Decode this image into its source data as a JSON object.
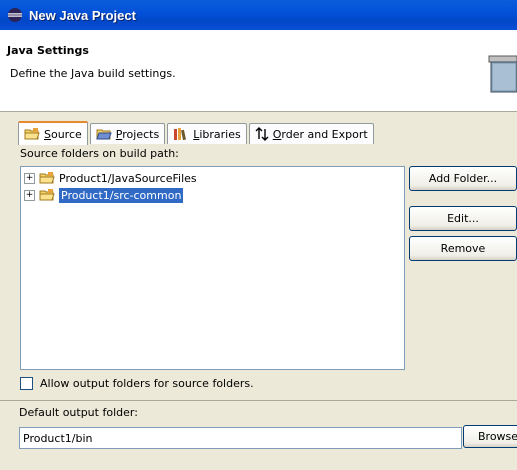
{
  "window": {
    "title": "New Java Project"
  },
  "banner": {
    "title": "Java Settings",
    "description": "Define the Java build settings."
  },
  "tabs": [
    {
      "label": "Source",
      "mnemonic": "S",
      "rest": "ource",
      "icon": "source-folder-icon",
      "active": true
    },
    {
      "label": "Projects",
      "mnemonic": "P",
      "rest": "rojects",
      "icon": "projects-icon",
      "active": false
    },
    {
      "label": "Libraries",
      "mnemonic": "L",
      "rest": "ibraries",
      "icon": "libraries-icon",
      "active": false
    },
    {
      "label": "Order and Export",
      "mnemonic": "O",
      "rest": "rder and Export",
      "icon": "order-export-icon",
      "active": false
    }
  ],
  "source": {
    "list_label": "Source folders on build path:",
    "folders": [
      {
        "name": "Product1/JavaSourceFiles",
        "selected": false
      },
      {
        "name": "Product1/src-common",
        "selected": true
      }
    ],
    "buttons": {
      "add_folder": "Add Folder...",
      "edit": "Edit...",
      "remove": "Remove"
    },
    "allow_output_label": "Allow output folders for source folders.",
    "allow_output_checked": false
  },
  "output": {
    "label": "Default output folder:",
    "value": "Product1/bin",
    "browse_label": "Browse..."
  },
  "colors": {
    "title_bar": "#0a5ddb",
    "selection": "#316ac5",
    "dialog_bg": "#ece9d8"
  }
}
